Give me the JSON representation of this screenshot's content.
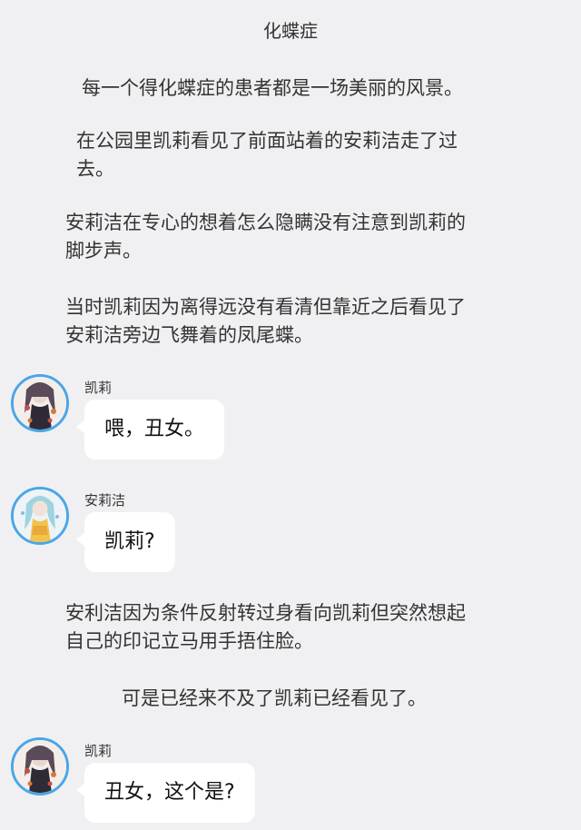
{
  "title": "化蝶症",
  "narration": {
    "p1": "每一个得化蝶症的患者都是一场美丽的风景。",
    "p2_line1": "在公园里凯莉看见了前面站着的安莉洁走了过",
    "p2_line2": "去。",
    "p3_line1": "安莉洁在专心的想着怎么隐瞒没有注意到凯莉的",
    "p3_line2": "脚步声。",
    "p4_line1": "当时凯莉因为离得远没有看清但靠近之后看见了",
    "p4_line2": "安莉洁旁边飞舞着的凤尾蝶。",
    "p5_line1": "安利洁因为条件反射转过身看向凯莉但突然想起",
    "p5_line2": "自己的印记立马用手捂住脸。",
    "p6": "可是已经来不及了凯莉已经看见了。"
  },
  "messages": [
    {
      "sender": "凯莉",
      "text": "喂，丑女。"
    },
    {
      "sender": "安莉洁",
      "text": "凯莉?"
    },
    {
      "sender": "凯莉",
      "text": "丑女，这个是?"
    }
  ],
  "colors": {
    "background": "#f0f0f2",
    "bubble": "#ffffff",
    "avatar_ring": "#4aa6e8"
  },
  "icons": {
    "avatar_kaili": "avatar-kaili-icon",
    "avatar_anlijie": "avatar-anlijie-icon"
  }
}
